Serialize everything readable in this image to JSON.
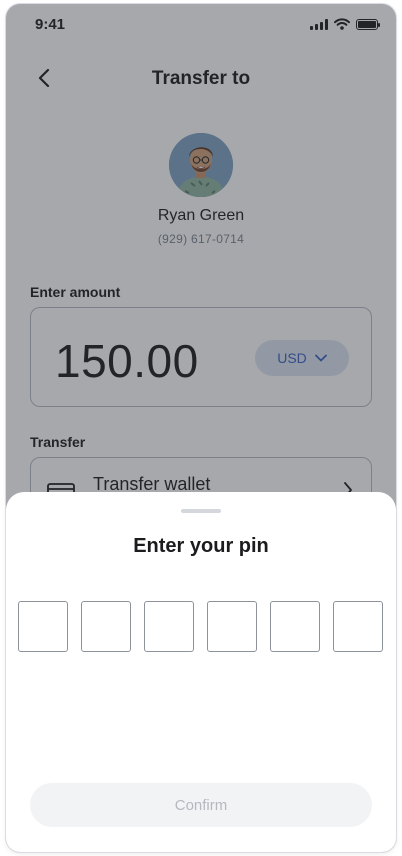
{
  "status_bar": {
    "time": "9:41"
  },
  "header": {
    "title": "Transfer to"
  },
  "recipient": {
    "name": "Ryan Green",
    "phone": "(929) 617-0714"
  },
  "amount": {
    "label": "Enter amount",
    "value": "150.00",
    "currency": "USD"
  },
  "transfer": {
    "label": "Transfer",
    "method": "Transfer wallet"
  },
  "pin_sheet": {
    "title": "Enter your pin",
    "pin_count": 6,
    "confirm_label": "Confirm"
  },
  "icons": {
    "back": "chevron-left-icon",
    "signal": "signal-icon",
    "wifi": "wifi-icon",
    "battery": "battery-icon",
    "currency_dropdown": "chevron-down-icon",
    "wallet": "wallet-icon",
    "wallet_next": "chevron-right-icon"
  },
  "colors": {
    "accent": "#3a63c4",
    "accent_bg": "#dfe6f3",
    "overlay": "#2c3038",
    "disabled_button_bg": "#f2f3f5",
    "disabled_button_text": "#b4b8bf"
  }
}
